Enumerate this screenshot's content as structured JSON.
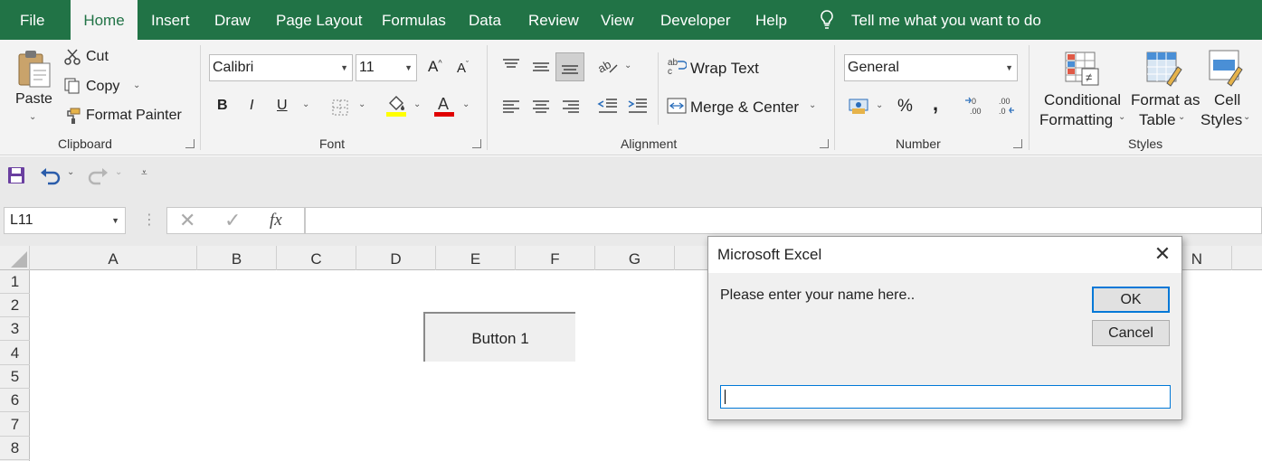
{
  "menu": {
    "tabs": [
      "File",
      "Home",
      "Insert",
      "Draw",
      "Page Layout",
      "Formulas",
      "Data",
      "Review",
      "View",
      "Developer",
      "Help"
    ],
    "active_tab": "Home",
    "tell_me": "Tell me what you want to do"
  },
  "ribbon": {
    "clipboard": {
      "paste": "Paste",
      "cut": "Cut",
      "copy": "Copy",
      "format_painter": "Format Painter",
      "label": "Clipboard"
    },
    "font": {
      "font_name": "Calibri",
      "font_size": "11",
      "bold": "B",
      "italic": "I",
      "underline": "U",
      "label": "Font"
    },
    "alignment": {
      "wrap_text": "Wrap Text",
      "merge_center": "Merge & Center",
      "label": "Alignment"
    },
    "number": {
      "format": "General",
      "percent": "%",
      "comma": ",",
      "label": "Number"
    },
    "styles": {
      "conditional_1": "Conditional",
      "conditional_2": "Formatting",
      "format_table_1": "Format as",
      "format_table_2": "Table",
      "cell_styles_1": "Cell",
      "cell_styles_2": "Styles",
      "label": "Styles"
    }
  },
  "formula_bar": {
    "name_box": "L11",
    "fx": "fx",
    "formula": ""
  },
  "sheet": {
    "columns": [
      "A",
      "B",
      "C",
      "D",
      "E",
      "F",
      "G",
      "N"
    ],
    "rows": [
      "1",
      "2",
      "3",
      "4",
      "5",
      "6",
      "7",
      "8"
    ],
    "button_label": "Button 1"
  },
  "dialog": {
    "title": "Microsoft Excel",
    "message": "Please enter your name here..",
    "ok": "OK",
    "cancel": "Cancel",
    "input_value": ""
  },
  "colors": {
    "excel_green": "#217346",
    "dialog_focus": "#0078d7",
    "font_color_red": "#e00000",
    "highlight_yellow": "#ffff00"
  }
}
